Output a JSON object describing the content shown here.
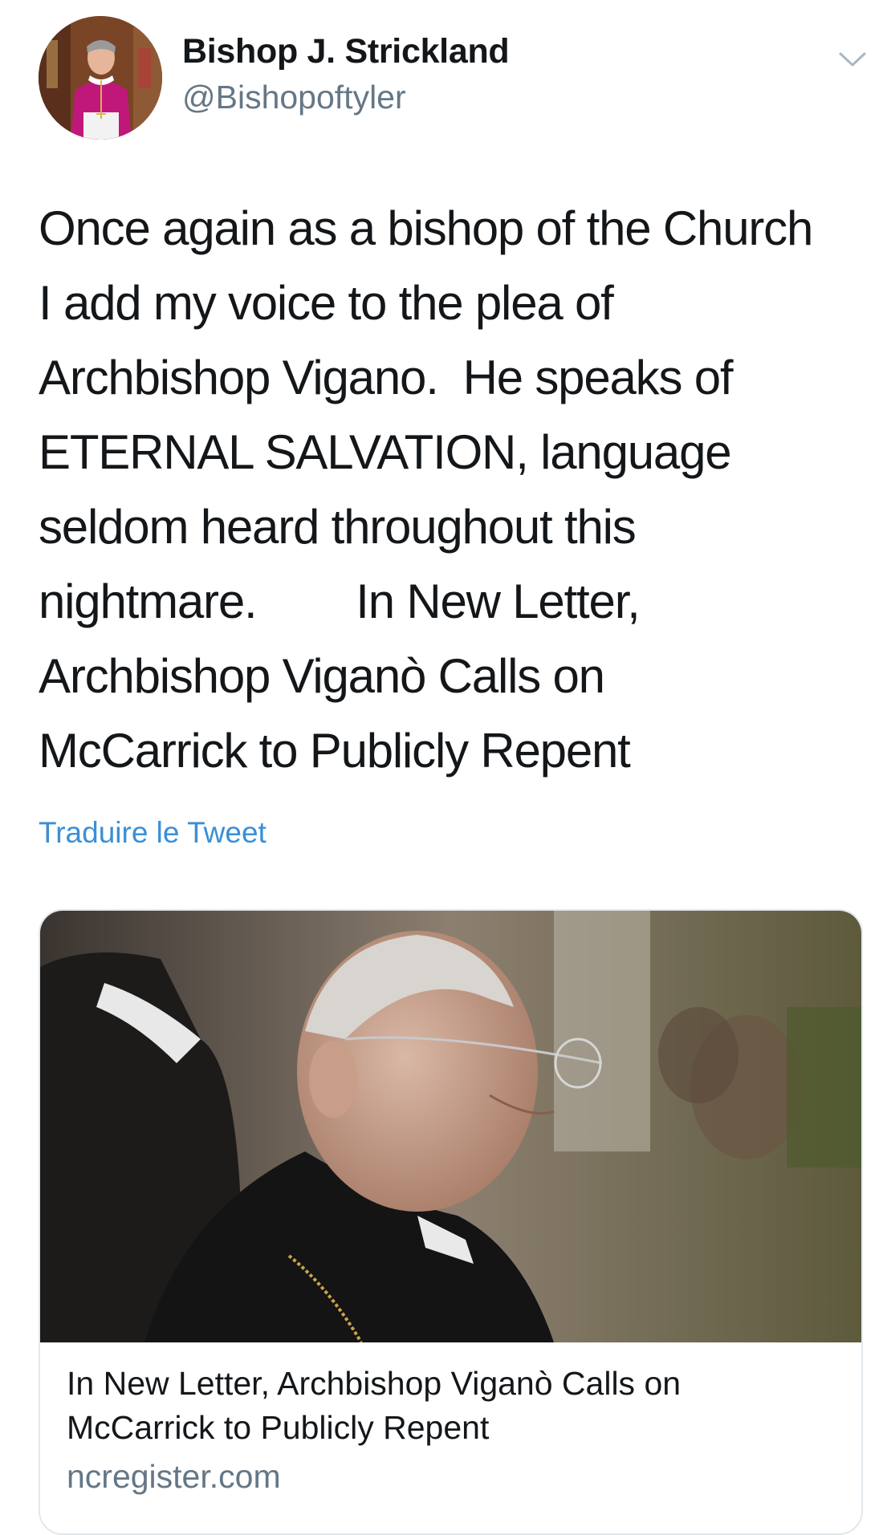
{
  "author": {
    "display_name": "Bishop J. Strickland",
    "handle": "@Bishopoftyler",
    "avatar_icon": "bishop-portrait-avatar"
  },
  "menu_icon": "chevron-down-icon",
  "tweet": {
    "lines": [
      "Once again as a bishop of the Church",
      "I add my voice to the plea of",
      "Archbishop Vigano.  He speaks of",
      "ETERNAL SALVATION, language",
      "seldom heard throughout this",
      "nightmare.        In New Letter,",
      "Archbishop Viganò Calls on",
      "McCarrick to Publicly Repent"
    ],
    "translate_label": "Traduire le Tweet"
  },
  "link_card": {
    "image_icon": "archbishop-photo",
    "title_lines": [
      "In New Letter, Archbishop Viganò Calls on",
      "McCarrick to Publicly Repent"
    ],
    "domain": "ncregister.com"
  },
  "colors": {
    "link_blue": "#3a8fd6",
    "secondary_gray": "#657786",
    "text_dark": "#14171a",
    "card_border": "#e1e8ed"
  }
}
